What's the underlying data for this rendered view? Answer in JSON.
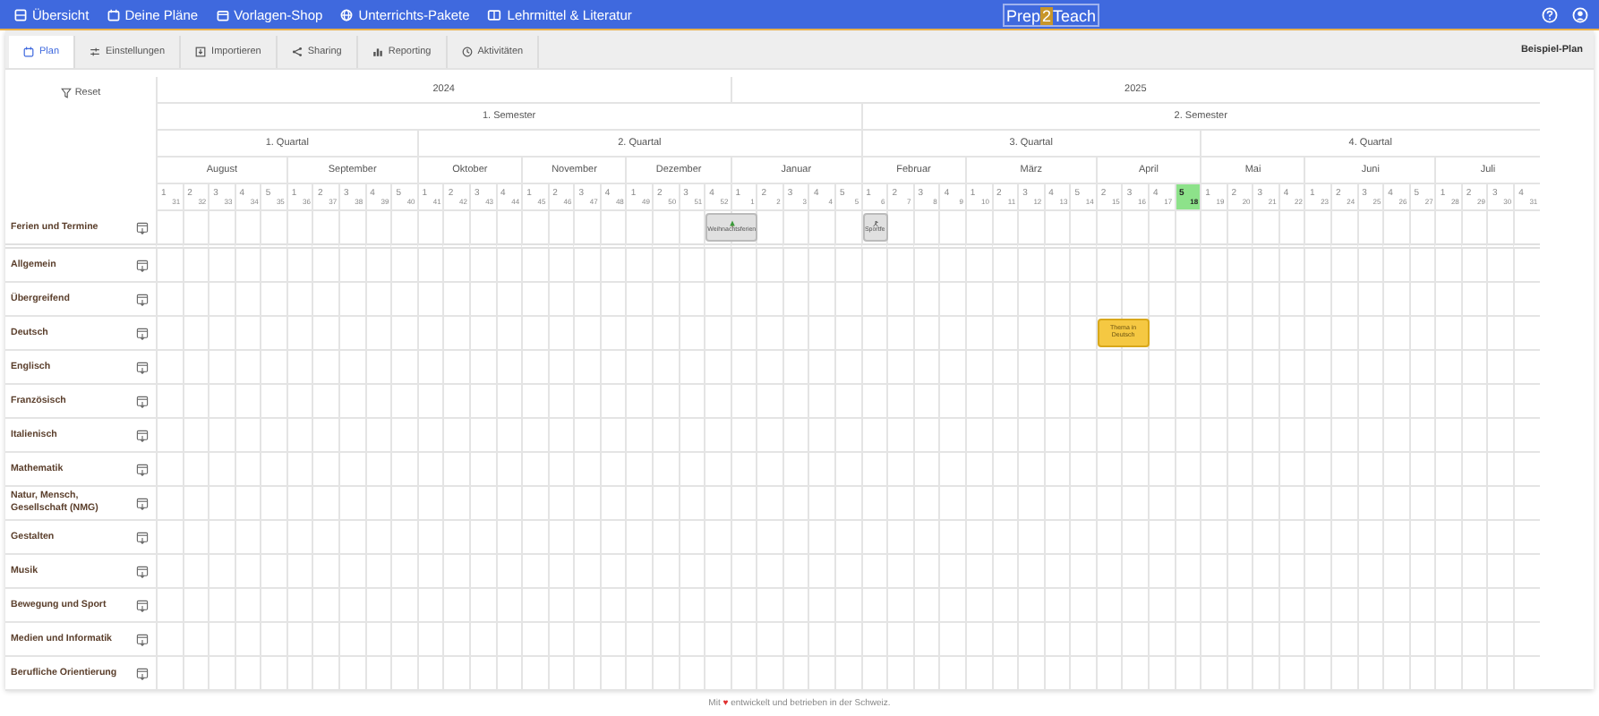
{
  "nav": {
    "items": [
      {
        "label": "Übersicht"
      },
      {
        "label": "Deine Pläne"
      },
      {
        "label": "Vorlagen-Shop"
      },
      {
        "label": "Unterrichts-Pakete"
      },
      {
        "label": "Lehrmittel & Literatur"
      }
    ],
    "logo": [
      "Prep",
      "2",
      "Teach"
    ]
  },
  "tabs": [
    {
      "label": "Plan",
      "selected": true
    },
    {
      "label": "Einstellungen",
      "selected": false
    },
    {
      "label": "Importieren",
      "selected": false
    },
    {
      "label": "Sharing",
      "selected": false
    },
    {
      "label": "Reporting",
      "selected": false
    },
    {
      "label": "Aktivitäten",
      "selected": false
    }
  ],
  "plan_name": "Beispiel-Plan",
  "reset": "Reset",
  "years": [
    {
      "label": "2024"
    },
    {
      "label": "2025"
    }
  ],
  "semesters": [
    {
      "label": "1. Semester"
    },
    {
      "label": "2. Semester"
    }
  ],
  "quarters": [
    {
      "label": "1. Quartal"
    },
    {
      "label": "2. Quartal"
    },
    {
      "label": "3. Quartal"
    },
    {
      "label": "4. Quartal"
    }
  ],
  "months": [
    {
      "label": "August",
      "weeks": [
        {
          "n": "1",
          "kw": "31",
          "current": false
        },
        {
          "n": "2",
          "kw": "32",
          "current": false
        },
        {
          "n": "3",
          "kw": "33",
          "current": false
        },
        {
          "n": "4",
          "kw": "34",
          "current": false
        },
        {
          "n": "5",
          "kw": "35",
          "current": false
        }
      ]
    },
    {
      "label": "September",
      "weeks": [
        {
          "n": "1",
          "kw": "36",
          "current": false
        },
        {
          "n": "2",
          "kw": "37",
          "current": false
        },
        {
          "n": "3",
          "kw": "38",
          "current": false
        },
        {
          "n": "4",
          "kw": "39",
          "current": false
        },
        {
          "n": "5",
          "kw": "40",
          "current": false
        }
      ]
    },
    {
      "label": "Oktober",
      "weeks": [
        {
          "n": "1",
          "kw": "41",
          "current": false
        },
        {
          "n": "2",
          "kw": "42",
          "current": false
        },
        {
          "n": "3",
          "kw": "43",
          "current": false
        },
        {
          "n": "4",
          "kw": "44",
          "current": false
        }
      ]
    },
    {
      "label": "November",
      "weeks": [
        {
          "n": "1",
          "kw": "45",
          "current": false
        },
        {
          "n": "2",
          "kw": "46",
          "current": false
        },
        {
          "n": "3",
          "kw": "47",
          "current": false
        },
        {
          "n": "4",
          "kw": "48",
          "current": false
        }
      ]
    },
    {
      "label": "Dezember",
      "weeks": [
        {
          "n": "1",
          "kw": "49",
          "current": false
        },
        {
          "n": "2",
          "kw": "50",
          "current": false
        },
        {
          "n": "3",
          "kw": "51",
          "current": false
        },
        {
          "n": "4",
          "kw": "52",
          "current": false
        }
      ]
    },
    {
      "label": "Januar",
      "weeks": [
        {
          "n": "1",
          "kw": "1",
          "current": false
        },
        {
          "n": "2",
          "kw": "2",
          "current": false
        },
        {
          "n": "3",
          "kw": "3",
          "current": false
        },
        {
          "n": "4",
          "kw": "4",
          "current": false
        },
        {
          "n": "5",
          "kw": "5",
          "current": false
        }
      ]
    },
    {
      "label": "Februar",
      "weeks": [
        {
          "n": "1",
          "kw": "6",
          "current": false
        },
        {
          "n": "2",
          "kw": "7",
          "current": false
        },
        {
          "n": "3",
          "kw": "8",
          "current": false
        },
        {
          "n": "4",
          "kw": "9",
          "current": false
        }
      ]
    },
    {
      "label": "März",
      "weeks": [
        {
          "n": "1",
          "kw": "10",
          "current": false
        },
        {
          "n": "2",
          "kw": "11",
          "current": false
        },
        {
          "n": "3",
          "kw": "12",
          "current": false
        },
        {
          "n": "4",
          "kw": "13",
          "current": false
        },
        {
          "n": "5",
          "kw": "14",
          "current": false
        }
      ]
    },
    {
      "label": "April",
      "weeks": [
        {
          "n": "2",
          "kw": "15",
          "current": false
        },
        {
          "n": "3",
          "kw": "16",
          "current": false
        },
        {
          "n": "4",
          "kw": "17",
          "current": false
        },
        {
          "n": "5",
          "kw": "18",
          "current": true
        }
      ]
    },
    {
      "label": "Mai",
      "weeks": [
        {
          "n": "1",
          "kw": "19",
          "current": false
        },
        {
          "n": "2",
          "kw": "20",
          "current": false
        },
        {
          "n": "3",
          "kw": "21",
          "current": false
        },
        {
          "n": "4",
          "kw": "22",
          "current": false
        }
      ]
    },
    {
      "label": "Juni",
      "weeks": [
        {
          "n": "1",
          "kw": "23",
          "current": false
        },
        {
          "n": "2",
          "kw": "24",
          "current": false
        },
        {
          "n": "3",
          "kw": "25",
          "current": false
        },
        {
          "n": "4",
          "kw": "26",
          "current": false
        },
        {
          "n": "5",
          "kw": "27",
          "current": false
        }
      ]
    },
    {
      "label": "Juli",
      "weeks": [
        {
          "n": "1",
          "kw": "28",
          "current": false
        },
        {
          "n": "2",
          "kw": "29",
          "current": false
        },
        {
          "n": "3",
          "kw": "30",
          "current": false
        },
        {
          "n": "4",
          "kw": "31",
          "current": false
        }
      ]
    }
  ],
  "rows": [
    {
      "label": "Ferien und Termine",
      "entries": [
        {
          "kind": "holiday",
          "label": "Weihnachtsferien",
          "color": "#e0e0e0"
        },
        {
          "kind": "event",
          "label": "Sportfe",
          "color": "#e0e0e0"
        }
      ]
    },
    {
      "label": "Allgemein"
    },
    {
      "label": "Übergreifend"
    },
    {
      "label": "Deutsch",
      "entries": [
        {
          "kind": "topic",
          "label": "Thema in Deutsch",
          "color": "#f5c842"
        }
      ]
    },
    {
      "label": "Englisch"
    },
    {
      "label": "Französisch"
    },
    {
      "label": "Italienisch"
    },
    {
      "label": "Mathematik"
    },
    {
      "label": "Natur, Mensch, Gesellschaft (NMG)"
    },
    {
      "label": "Gestalten"
    },
    {
      "label": "Musik"
    },
    {
      "label": "Bewegung und Sport"
    },
    {
      "label": "Medien und Informatik"
    },
    {
      "label": "Berufliche Orientierung"
    }
  ],
  "footer": {
    "before": "Mit",
    "heart": "♥",
    "after": "entwickelt und betrieben in der Schweiz."
  }
}
